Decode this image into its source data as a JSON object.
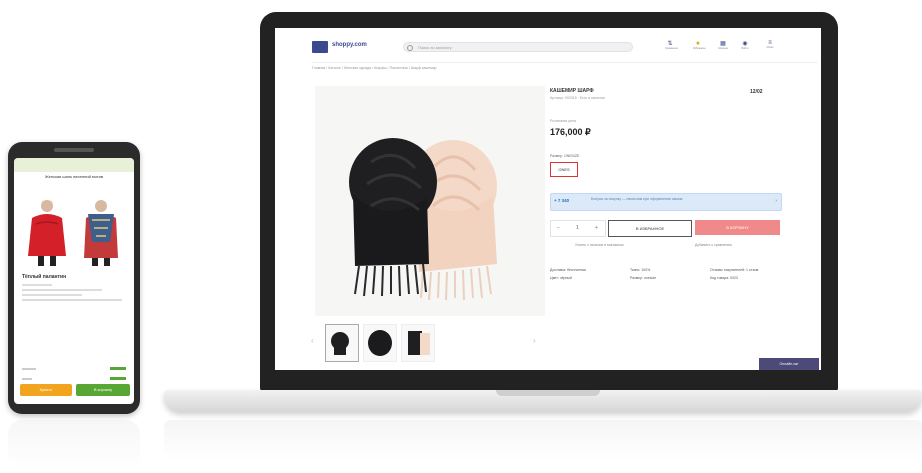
{
  "phone": {
    "page_title": "Женская шаль весенний мотив",
    "product_name": "Тёплый палантин",
    "btn_left": "Купить",
    "btn_right": "В корзину"
  },
  "site": {
    "logo": "shoppy.com",
    "search_placeholder": "Поиск по каталогу",
    "header_icons": [
      {
        "name": "compare-icon",
        "glyph": "⇅",
        "label": "Сравнение"
      },
      {
        "name": "favorites-icon",
        "glyph": "★",
        "label": "Избранное"
      },
      {
        "name": "cart-icon",
        "glyph": "▦",
        "label": "Корзина"
      },
      {
        "name": "user-icon",
        "glyph": "◉",
        "label": "Войти"
      },
      {
        "name": "menu-icon",
        "glyph": "≡",
        "label": "Меню"
      }
    ],
    "breadcrumb": "Главная / Каталог / Женская одежда / Шарфы / Палантины / Шарф кашемир"
  },
  "product": {
    "title": "КАШЕМИР ШАРФ",
    "subtitle": "Артикул: 002315 · Есть в наличии",
    "code": "12/02",
    "price_label": "Розничная цена",
    "price": "176,000 ₽",
    "size_label": "Размер: ONESIZE",
    "size_value": "ONES",
    "info_tag": "+ 7 340",
    "info_text": "Бонусы за покупку — начислим при оформлении заказа",
    "qty_minus": "−",
    "qty_value": "1",
    "qty_plus": "+",
    "btn_outline": "В ИЗБРАННОЕ",
    "btn_pink": "В КОРЗИНУ",
    "link1": "Узнать о наличии в магазинах",
    "link2": "Добавить к сравнению",
    "specs": [
      "Доставка: бесплатная",
      "Цвет: чёрный",
      "Ткань: 100%",
      "Размер: onesize",
      "Отзывы покупателей: 1 отзыв",
      "Код товара: 0023"
    ],
    "chat": "Онлайн-чат"
  },
  "colors": {
    "brand": "#3b4a8f",
    "accent_pink": "#f08a8a",
    "info_blue": "#dbe9f9",
    "phone_orange": "#f3a41f",
    "phone_green": "#58a633"
  }
}
